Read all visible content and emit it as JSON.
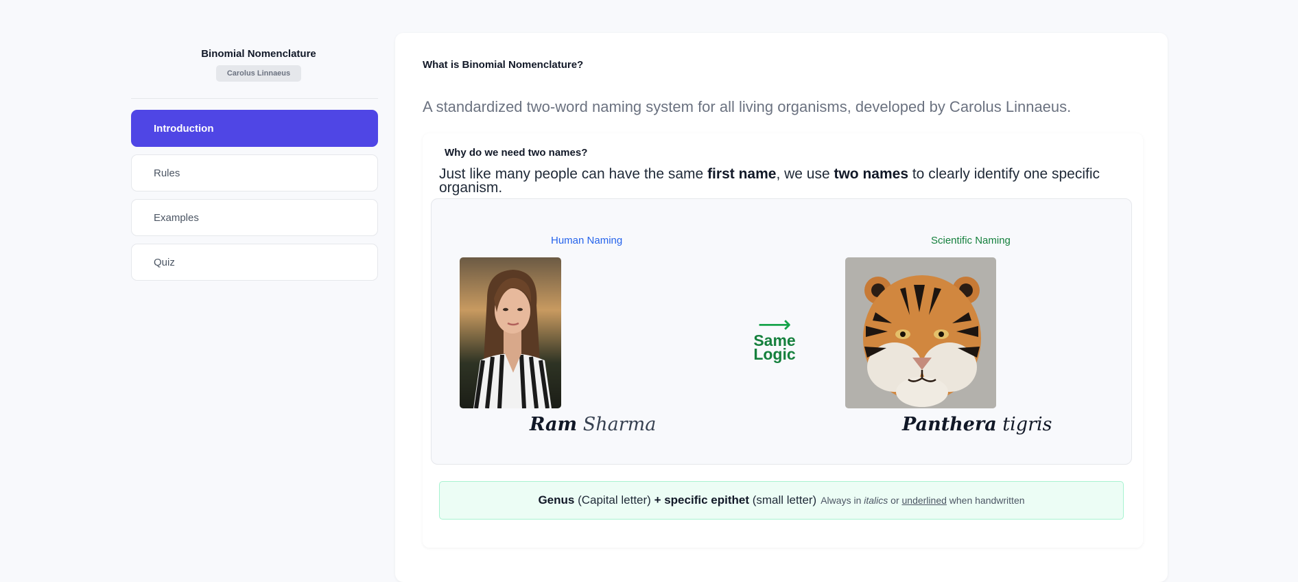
{
  "sidebar": {
    "title": "Binomial Nomenclature",
    "badge": "Carolus Linnaeus",
    "items": [
      {
        "label": "Introduction",
        "active": true
      },
      {
        "label": "Rules",
        "active": false
      },
      {
        "label": "Examples",
        "active": false
      },
      {
        "label": "Quiz",
        "active": false
      }
    ]
  },
  "main": {
    "title": "What is Binomial Nomenclature?",
    "lead": "A standardized two-word naming system for all living organisms, developed by Carolus Linnaeus.",
    "why": {
      "heading": "Why do we need two names?",
      "text_1": "Just like many people can have the same ",
      "text_bold_1": "first name",
      "text_2": ", we use ",
      "text_bold_2": "two names",
      "text_3": " to clearly identify one specific organism."
    },
    "comparison": {
      "human_label": "Human Naming",
      "scientific_label": "Scientific Naming",
      "arrow_icon": "right-arrow-icon",
      "arrow_glyph": "⟶",
      "arrow_line_1": "Same",
      "arrow_line_2": "Logic",
      "human_first": "Ram",
      "human_last": "Sharma",
      "sci_genus": "Panthera",
      "sci_species": "tigris"
    },
    "rule": {
      "genus": "Genus",
      "genus_note": " (Capital letter) ",
      "plus": "+",
      "epithet": " specific epithet",
      "epithet_note": " (small letter)",
      "small_1": "Always in ",
      "small_italic": "italics",
      "small_2": " or ",
      "small_underline": "underlined",
      "small_3": " when handwritten"
    }
  },
  "colors": {
    "accent": "#4f46e5",
    "human_label": "#2563eb",
    "scientific_label": "#15803d",
    "rule_bg": "#ecfdf5"
  }
}
